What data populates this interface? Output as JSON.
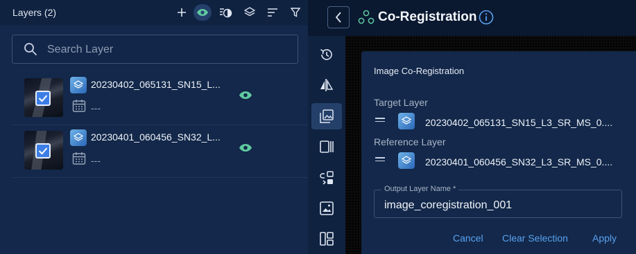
{
  "layers_panel": {
    "title": "Layers (2)",
    "header_icons": [
      "add-icon",
      "eye-icon",
      "contrast-icon",
      "layers-icon",
      "sort-icon",
      "filter-icon"
    ],
    "search": {
      "placeholder": "Search Layer",
      "value": ""
    },
    "layers": [
      {
        "name": "20230402_065131_SN15_L...",
        "date": "---",
        "checked": true,
        "visible": true
      },
      {
        "name": "20230401_060456_SN32_L...",
        "date": "---",
        "checked": true,
        "visible": true
      }
    ]
  },
  "tool": {
    "title": "Co-Registration",
    "rail_icons": [
      "history-icon",
      "compare-icon",
      "image-stack-icon",
      "panel-icon",
      "swap-icon",
      "image-icon",
      "layout-icon"
    ],
    "active_rail": "image-stack-icon"
  },
  "coregistration": {
    "card_title": "Image Co-Registration",
    "target_label": "Target Layer",
    "target_value": "20230402_065131_SN15_L3_SR_MS_0....",
    "reference_label": "Reference Layer",
    "reference_value": "20230401_060456_SN32_L3_SR_MS_0....",
    "output_label": "Output Layer Name *",
    "output_value": "image_coregistration_001",
    "cancel_label": "Cancel",
    "clear_label": "Clear Selection",
    "apply_label": "Apply"
  },
  "colors": {
    "accent": "#5aa2f0",
    "eye_green": "#5fc9a0",
    "panel_bg": "#13284a",
    "checkbox": "#3d7ee6"
  }
}
